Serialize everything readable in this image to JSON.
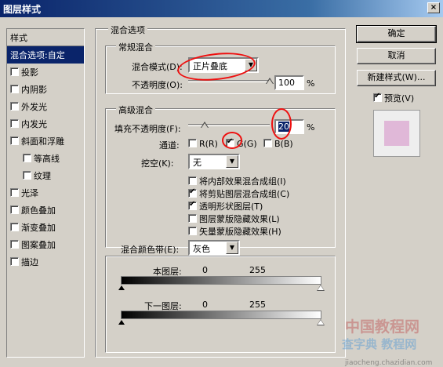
{
  "window": {
    "title": "图层样式",
    "close": "×"
  },
  "sidebar": {
    "header": "样式",
    "items": [
      {
        "label": "混合选项:自定",
        "checkbox": false,
        "selected": true
      },
      {
        "label": "投影",
        "checkbox": true,
        "checked": false
      },
      {
        "label": "内阴影",
        "checkbox": true,
        "checked": false
      },
      {
        "label": "外发光",
        "checkbox": true,
        "checked": false
      },
      {
        "label": "内发光",
        "checkbox": true,
        "checked": false
      },
      {
        "label": "斜面和浮雕",
        "checkbox": true,
        "checked": false
      },
      {
        "label": "等高线",
        "checkbox": true,
        "checked": false,
        "sub": true
      },
      {
        "label": "纹理",
        "checkbox": true,
        "checked": false,
        "sub": true
      },
      {
        "label": "光泽",
        "checkbox": true,
        "checked": false
      },
      {
        "label": "颜色叠加",
        "checkbox": true,
        "checked": false
      },
      {
        "label": "渐变叠加",
        "checkbox": true,
        "checked": false
      },
      {
        "label": "图案叠加",
        "checkbox": true,
        "checked": false
      },
      {
        "label": "描边",
        "checkbox": true,
        "checked": false
      }
    ]
  },
  "blend_options": {
    "title": "混合选项",
    "general": {
      "title": "常规混合",
      "mode_label": "混合模式(D):",
      "mode_value": "正片叠底",
      "opacity_label": "不透明度(O):",
      "opacity_value": "100",
      "opacity_unit": "%",
      "opacity_percent": 100
    },
    "advanced": {
      "title": "高级混合",
      "fill_label": "填充不透明度(F):",
      "fill_value": "20",
      "fill_unit": "%",
      "fill_percent": 20,
      "channels_label": "通道:",
      "channel_r": "R(R)",
      "channel_g": "G(G)",
      "channel_b": "B(B)",
      "knockout_label": "挖空(K):",
      "knockout_value": "无",
      "options": [
        {
          "label": "将内部效果混合成组(I)",
          "checked": false
        },
        {
          "label": "将剪贴图层混合成组(C)",
          "checked": true
        },
        {
          "label": "透明形状图层(T)",
          "checked": true
        },
        {
          "label": "图层蒙版隐藏效果(L)",
          "checked": false
        },
        {
          "label": "矢量蒙版隐藏效果(H)",
          "checked": false
        }
      ]
    },
    "blend_if": {
      "label": "混合颜色带(E):",
      "value": "灰色",
      "this_layer_label": "本图层:",
      "this_layer_min": "0",
      "this_layer_max": "255",
      "under_layer_label": "下一图层:",
      "under_layer_min": "0",
      "under_layer_max": "255"
    }
  },
  "buttons": {
    "ok": "确定",
    "cancel": "取消",
    "new_style": "新建样式(W)...",
    "preview": "预览(V)"
  },
  "watermark": {
    "line1": "中国教程网",
    "line2": "查字典 教程网",
    "line3": "jiaocheng.chazidian.com"
  },
  "colors": {
    "selection": "#0a246a",
    "annotation": "#ee1010",
    "preview_swatch": "#e0b8d8"
  }
}
